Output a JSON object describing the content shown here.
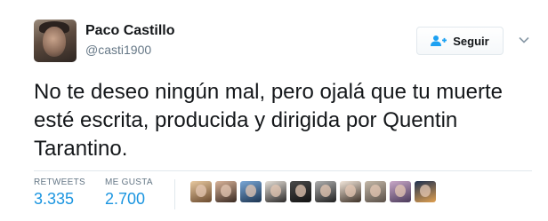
{
  "author": {
    "name": "Paco Castillo",
    "handle": "@casti1900",
    "avatar_icon": "user-avatar-photo"
  },
  "follow_button": {
    "label": "Seguir",
    "icon": "follow-user-plus-icon",
    "accent": "#1da1f2"
  },
  "menu": {
    "icon": "chevron-down-icon"
  },
  "tweet": {
    "text": "No te deseo ningún mal, pero ojalá que tu muerte esté escrita, producida y dirigida por Quentin Tarantino."
  },
  "stats": {
    "retweets_label": "RETWEETS",
    "retweets_value": "3.335",
    "likes_label": "ME GUSTA",
    "likes_value": "2.700",
    "value_color": "#1b95e0"
  },
  "likers": [
    {
      "colors": [
        "#e8c9a0",
        "#6b4a2e"
      ]
    },
    {
      "colors": [
        "#d9b49a",
        "#3a2a22"
      ]
    },
    {
      "colors": [
        "#7aa7d6",
        "#1c3450"
      ]
    },
    {
      "colors": [
        "#e6e0d8",
        "#2c2a2a"
      ]
    },
    {
      "colors": [
        "#4a4a4a",
        "#121212"
      ]
    },
    {
      "colors": [
        "#b0b0b0",
        "#202020"
      ]
    },
    {
      "colors": [
        "#f2e6da",
        "#3c3026"
      ]
    },
    {
      "colors": [
        "#c4b8a8",
        "#5a5048"
      ]
    },
    {
      "colors": [
        "#c9a8c8",
        "#4a3a5a"
      ]
    },
    {
      "colors": [
        "#1e3050",
        "#e0a050"
      ]
    }
  ]
}
